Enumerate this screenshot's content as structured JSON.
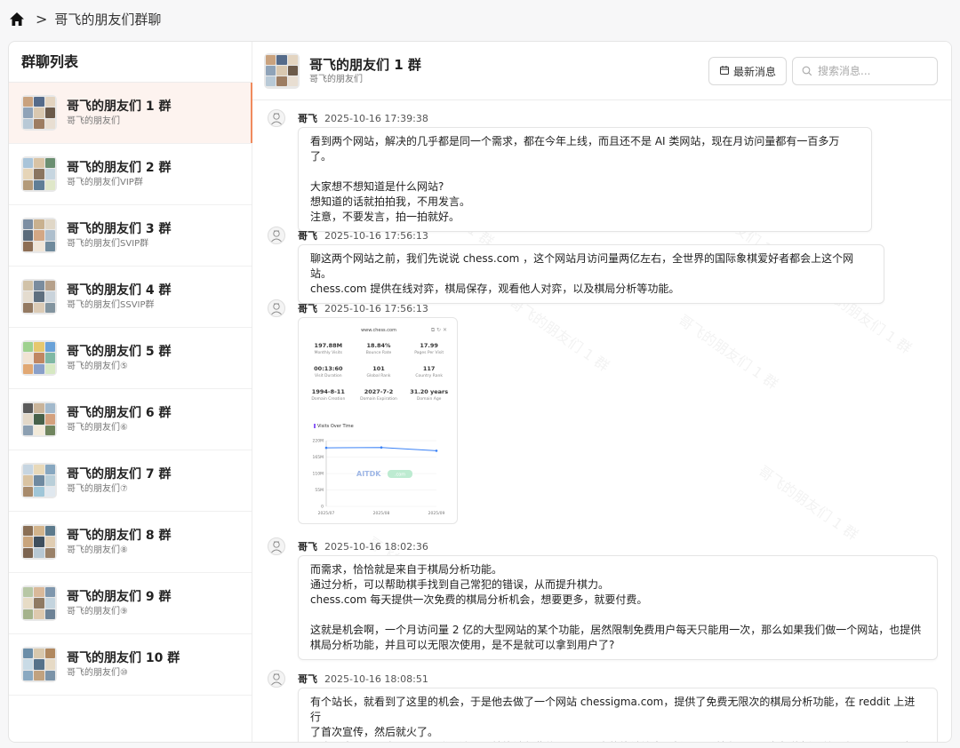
{
  "breadcrumb": {
    "home_icon": "home-icon",
    "separator": ">",
    "current": "哥飞的朋友们群聊"
  },
  "sidebar": {
    "title": "群聊列表",
    "groups": [
      {
        "name": "哥飞的朋友们 1 群",
        "sub": "哥飞的朋友们"
      },
      {
        "name": "哥飞的朋友们 2 群",
        "sub": "哥飞的朋友们VIP群"
      },
      {
        "name": "哥飞的朋友们 3 群",
        "sub": "哥飞的朋友们SVIP群"
      },
      {
        "name": "哥飞的朋友们 4 群",
        "sub": "哥飞的朋友们SSVIP群"
      },
      {
        "name": "哥飞的朋友们 5 群",
        "sub": "哥飞的朋友们⑤"
      },
      {
        "name": "哥飞的朋友们 6 群",
        "sub": "哥飞的朋友们⑥"
      },
      {
        "name": "哥飞的朋友们 7 群",
        "sub": "哥飞的朋友们⑦"
      },
      {
        "name": "哥飞的朋友们 8 群",
        "sub": "哥飞的朋友们⑧"
      },
      {
        "name": "哥飞的朋友们 9 群",
        "sub": "哥飞的朋友们⑨"
      },
      {
        "name": "哥飞的朋友们 10 群",
        "sub": "哥飞的朋友们⑩"
      }
    ]
  },
  "chat": {
    "title": "哥飞的朋友们 1 群",
    "subtitle": "哥飞的朋友们",
    "latest_label": "最新消息",
    "search_placeholder": "搜索消息...",
    "watermark": "哥飞的朋友们 1 群",
    "messages": [
      {
        "sender": "哥飞",
        "time": "2025-10-16 17:39:38",
        "lines": [
          "看到两个网站，解决的几乎都是同一个需求，都在今年上线，而且还不是 AI 类网站，现在月访问量都有一百多万了。",
          "",
          "大家想不想知道是什么网站?",
          "想知道的话就拍拍我，不用发言。",
          "注意，不要发言，拍一拍就好。"
        ]
      },
      {
        "sender": "哥飞",
        "time": "2025-10-16 17:56:13",
        "lines": [
          "聊这两个网站之前，我们先说说 chess.com ，这个网站月访问量两亿左右，全世界的国际象棋爱好者都会上这个网站。",
          "chess.com 提供在线对弈，棋局保存，观看他人对弈，以及棋局分析等功能。"
        ]
      },
      {
        "sender": "哥飞",
        "time": "2025-10-16 17:56:13",
        "image": {
          "domain": "www.chess.com",
          "stats": [
            {
              "value": "197.88M",
              "label": "Monthly Visits"
            },
            {
              "value": "18.84%",
              "label": "Bounce Rate"
            },
            {
              "value": "17.99",
              "label": "Pages Per Visit"
            },
            {
              "value": "00:13:60",
              "label": "Visit Duration"
            },
            {
              "value": "101",
              "label": "Global Rank"
            },
            {
              "value": "117",
              "label": "Country Rank"
            },
            {
              "value": "1994-8-11",
              "label": "Domain Creation"
            },
            {
              "value": "2027-7-2",
              "label": "Domain Expiration"
            },
            {
              "value": "31.20 years",
              "label": "Domain Age"
            }
          ],
          "chart_title": "Visits Over Time",
          "y_ticks": [
            "220M",
            "165M",
            "110M",
            "55M",
            "0"
          ],
          "x_ticks": [
            "2025/07",
            "2025/08",
            "2025/09"
          ],
          "watermark": "AITDK",
          "watermark_badge": ".com"
        }
      },
      {
        "sender": "哥飞",
        "time": "2025-10-16 18:02:36",
        "lines": [
          "而需求，恰恰就是来自于棋局分析功能。",
          "通过分析，可以帮助棋手找到自己常犯的错误，从而提升棋力。",
          "chess.com 每天提供一次免费的棋局分析机会，想要更多，就要付费。",
          "",
          "这就是机会啊，一个月访问量 2 亿的大型网站的某个功能，居然限制免费用户每天只能用一次，那么如果我们做一个网站，也提供",
          "棋局分析功能，并且可以无限次使用，是不是就可以拿到用户了?"
        ]
      },
      {
        "sender": "哥飞",
        "time": "2025-10-16 18:08:51",
        "lines": [
          "有个站长，就看到了这里的机会，于是他去做了一个网站 chessigma.com，提供了免费无限次的棋局分析功能，在 reddit 上进行",
          "了首次宣传，然后就火了。",
          "用户进来用了，发现不需要登录注册，就能够免费使用，而且真的能够给出分析，于是就在圈子里争相传播，并且在reddit 顶贴回"
        ]
      }
    ]
  },
  "chart_data": {
    "type": "line",
    "title": "Visits Over Time",
    "categories": [
      "2025/07",
      "2025/08",
      "2025/09"
    ],
    "values": [
      196,
      197,
      186
    ],
    "ylim": [
      0,
      220
    ],
    "y_ticks": [
      "220M",
      "165M",
      "110M",
      "55M",
      "0"
    ],
    "color": "#3b82f6"
  },
  "colors": {
    "accent": "#f08a5d",
    "active_bg": "#fdf3ef",
    "line": "#3b82f6",
    "badge": "#4cd18a"
  }
}
